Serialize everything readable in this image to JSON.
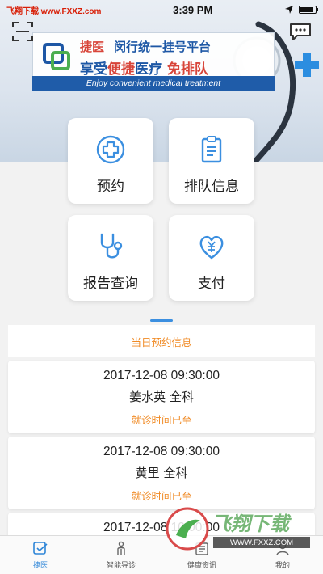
{
  "status_bar": {
    "carrier": "飞翔下载 www.FXXZ.com",
    "time": "3:39 PM",
    "battery_level": 0.9
  },
  "banner": {
    "brand_name": "捷医",
    "brand_tagline": "闵行统一挂号平台",
    "slogan_prefix": "享受",
    "slogan_highlight": "便捷",
    "slogan_middle": "医疗  ",
    "slogan_suffix": "免排队",
    "slogan_en": "Enjoy convenient medical treatment",
    "icons": {
      "left": "scan-icon",
      "right": "message-icon"
    }
  },
  "menu": {
    "items": [
      {
        "label": "预约",
        "icon": "medical-cross-icon"
      },
      {
        "label": "排队信息",
        "icon": "clipboard-icon"
      },
      {
        "label": "报告查询",
        "icon": "stethoscope-icon"
      },
      {
        "label": "支付",
        "icon": "yuan-heart-icon"
      }
    ]
  },
  "appointments": {
    "title": "当日预约信息",
    "records": [
      {
        "time": "2017-12-08 09:30:00",
        "doctor": "姜水英  全科",
        "status": "就诊时间已至"
      },
      {
        "time": "2017-12-08 09:30:00",
        "doctor": "黄里  全科",
        "status": "就诊时间已至"
      },
      {
        "time": "2017-12-08 10:00:00",
        "doctor": "",
        "status": ""
      }
    ]
  },
  "tab_bar": {
    "tabs": [
      {
        "label": "捷医",
        "icon": "home-check-icon",
        "active": true
      },
      {
        "label": "智能导诊",
        "icon": "person-guide-icon",
        "active": false
      },
      {
        "label": "健康资讯",
        "icon": "news-icon",
        "active": false
      },
      {
        "label": "我的",
        "icon": "user-icon",
        "active": false
      }
    ]
  },
  "watermark": {
    "text": "飞翔下载",
    "url": "WWW.FXXZ.COM"
  },
  "colors": {
    "accent": "#2f86d8",
    "orange": "#f08a24",
    "brand_blue": "#1d57a5",
    "brand_red": "#d8453a"
  }
}
